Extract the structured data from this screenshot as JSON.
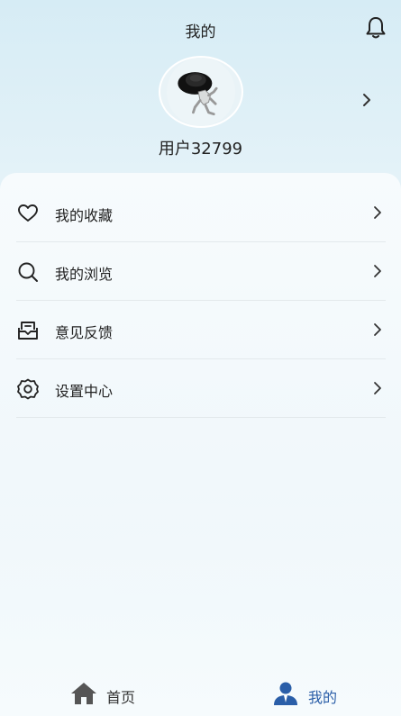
{
  "header": {
    "title": "我的",
    "bell_icon": "bell-icon"
  },
  "profile": {
    "username": "用户32799",
    "avatar_icon": "avatar-image",
    "chevron_icon": "chevron-right-icon"
  },
  "menu": [
    {
      "label": "我的收藏",
      "icon": "heart-icon"
    },
    {
      "label": "我的浏览",
      "icon": "search-icon"
    },
    {
      "label": "意见反馈",
      "icon": "mail-icon"
    },
    {
      "label": "设置中心",
      "icon": "gear-icon"
    }
  ],
  "tabbar": {
    "items": [
      {
        "label": "首页",
        "icon": "home-icon",
        "color": "#333333"
      },
      {
        "label": "我的",
        "icon": "user-icon",
        "color": "#2a5ea8",
        "active": true
      }
    ]
  },
  "colors": {
    "accent": "#2a5ea8",
    "text": "#222222"
  }
}
